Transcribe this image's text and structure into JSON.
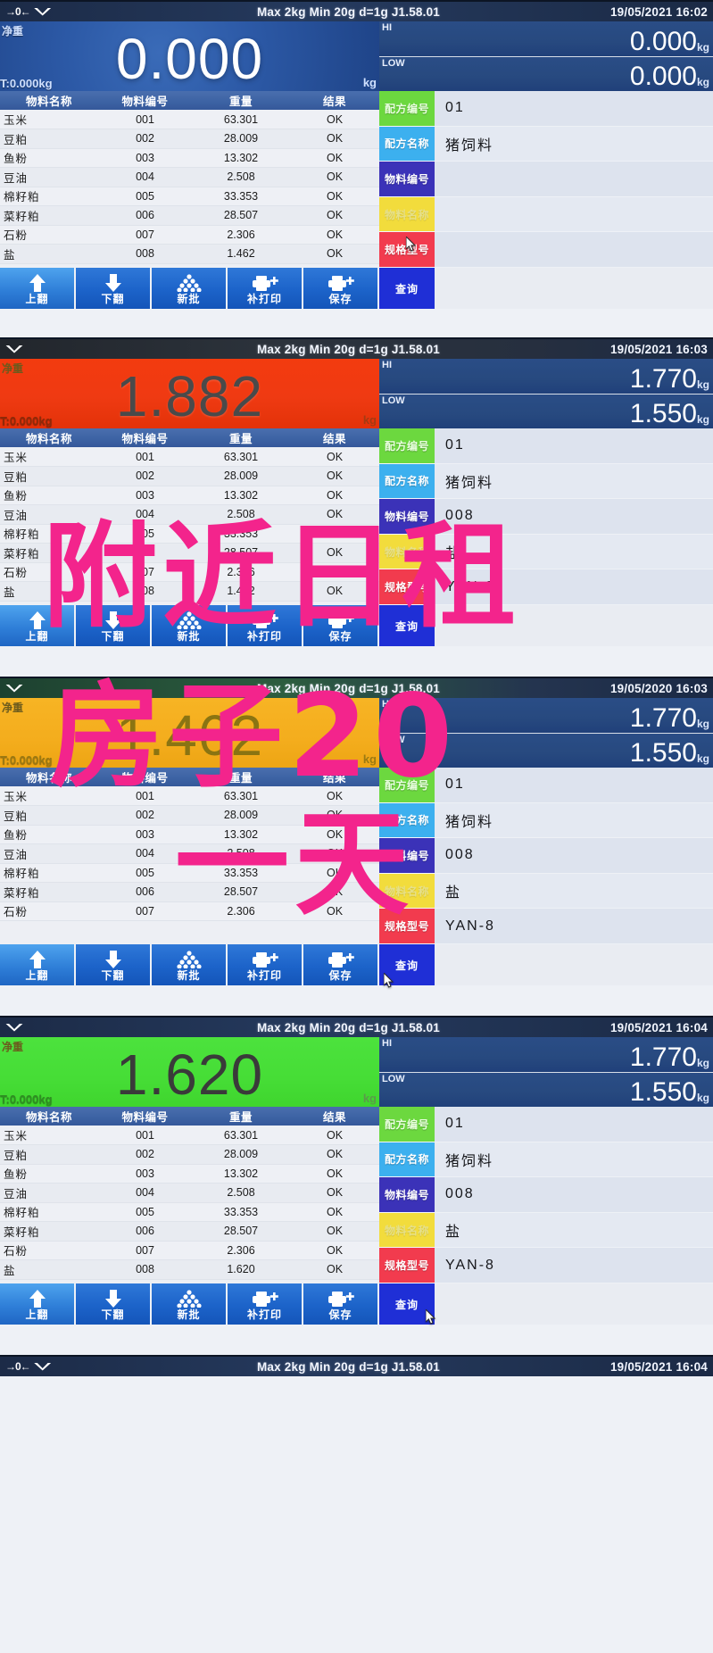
{
  "device": {
    "status_bar": {
      "zero_icon": "→0←",
      "stable_icon": "stability-indicator",
      "spec": "Max 2kg  Min 20g  d=1g    J1.58.01",
      "version": "J1.58.01"
    },
    "labels": {
      "net": "净重",
      "tare": "T:0.000kg",
      "unit": "kg",
      "hi": "HI",
      "low": "LOW"
    },
    "table": {
      "headers": [
        "物料名称",
        "物料编号",
        "重量",
        "结果"
      ],
      "rows": [
        {
          "name": "玉米",
          "code": "001",
          "weight": "63.301",
          "result": "OK"
        },
        {
          "name": "豆粕",
          "code": "002",
          "weight": "28.009",
          "result": "OK"
        },
        {
          "name": "鱼粉",
          "code": "003",
          "weight": "13.302",
          "result": "OK"
        },
        {
          "name": "豆油",
          "code": "004",
          "weight": "2.508",
          "result": "OK"
        },
        {
          "name": "棉籽粕",
          "code": "005",
          "weight": "33.353",
          "result": "OK"
        },
        {
          "name": "菜籽粕",
          "code": "006",
          "weight": "28.507",
          "result": "OK"
        },
        {
          "name": "石粉",
          "code": "007",
          "weight": "2.306",
          "result": "OK"
        },
        {
          "name": "盐",
          "code": "008",
          "weight": "1.462",
          "result": "OK"
        }
      ],
      "rows_final": [
        {
          "name": "玉米",
          "code": "001",
          "weight": "63.301",
          "result": "OK"
        },
        {
          "name": "豆粕",
          "code": "002",
          "weight": "28.009",
          "result": "OK"
        },
        {
          "name": "鱼粉",
          "code": "003",
          "weight": "13.302",
          "result": "OK"
        },
        {
          "name": "豆油",
          "code": "004",
          "weight": "2.508",
          "result": "OK"
        },
        {
          "name": "棉籽粕",
          "code": "005",
          "weight": "33.353",
          "result": "OK"
        },
        {
          "name": "菜籽粕",
          "code": "006",
          "weight": "28.507",
          "result": "OK"
        },
        {
          "name": "石粉",
          "code": "007",
          "weight": "2.306",
          "result": "OK"
        },
        {
          "name": "盐",
          "code": "008",
          "weight": "1.620",
          "result": "OK"
        }
      ]
    },
    "side_keys": [
      {
        "label": "配方编号",
        "color": "#6cd83f"
      },
      {
        "label": "配方名称",
        "color": "#3cb0ef"
      },
      {
        "label": "物料编号",
        "color": "#3b32b8"
      },
      {
        "label": "物料名称",
        "color": "#f2dc3c"
      },
      {
        "label": "规格型号",
        "color": "#f23b4e"
      },
      {
        "label": "查询",
        "color": "#1f2fd6"
      }
    ],
    "toolbar": [
      {
        "label": "上翻",
        "icon": "arrow-up-icon"
      },
      {
        "label": "下翻",
        "icon": "arrow-down-icon"
      },
      {
        "label": "新批",
        "icon": "batch-dots-icon"
      },
      {
        "label": "补打印",
        "icon": "printer-plus-icon"
      },
      {
        "label": "保存",
        "icon": "printer-save-icon"
      }
    ],
    "query_label": "查询"
  },
  "panels": [
    {
      "id": "panel-1",
      "datetime": "19/05/2021 16:02",
      "weight": "0.000",
      "weight_color": "#2c59a6",
      "bar_style": "blue",
      "hi": "0.000",
      "low": "0.000",
      "side_values": [
        "01",
        "猪饲料",
        "",
        "",
        ""
      ],
      "table_key": "rows"
    },
    {
      "id": "panel-2",
      "datetime": "19/05/2021 16:03",
      "weight": "1.882",
      "weight_color": "#ef3a12",
      "bar_style": "dark",
      "hi": "1.770",
      "low": "1.550",
      "side_values": [
        "01",
        "猪饲料",
        "008",
        "盐",
        "YAN-8"
      ],
      "table_key": "rows"
    },
    {
      "id": "panel-3",
      "datetime": "19/05/2020 16:03",
      "weight": "1.462",
      "weight_color": "#f4ad1d",
      "bar_style": "green",
      "hi": "1.770",
      "low": "1.550",
      "side_values": [
        "01",
        "猪饲料",
        "008",
        "盐",
        "YAN-8"
      ],
      "table_key": "rows"
    },
    {
      "id": "panel-4",
      "datetime": "19/05/2021 16:04",
      "weight": "1.620",
      "weight_color": "#46dd36",
      "bar_style": "blue",
      "hi": "1.770",
      "low": "1.550",
      "side_values": [
        "01",
        "猪饲料",
        "008",
        "盐",
        "YAN-8"
      ],
      "table_key": "rows_final"
    },
    {
      "id": "panel-5",
      "datetime": "19/05/2021 16:04",
      "weight": "",
      "bar_style": "blue"
    }
  ],
  "overlay": {
    "color": "#f3248c",
    "line1": "附近日租",
    "line2": "房子20",
    "line3": "一天"
  }
}
